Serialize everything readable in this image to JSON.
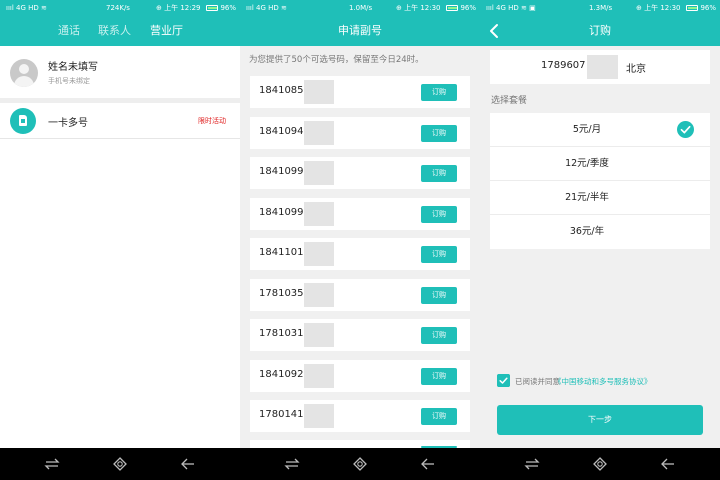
{
  "colors": {
    "accent": "#1fbfb8",
    "badge_red": "#e02020",
    "mask": "#e4e4e4"
  },
  "status_bars": [
    {
      "signal": "ıııl 4G HD ≋",
      "speed": "724K/s",
      "clock": "⊕ 上午 12:29",
      "battery_pct": "96%"
    },
    {
      "signal": "ıııl 4G HD ≋",
      "speed": "1.0M/s",
      "clock": "⊕ 上午 12:30",
      "battery_pct": "96%"
    },
    {
      "signal": "ıııl 4G HD ≋ ▣",
      "speed": "1.3M/s",
      "clock": "⊕ 上午 12:30",
      "battery_pct": "96%"
    }
  ],
  "screen1": {
    "tabs": [
      "通话",
      "联系人",
      "营业厅"
    ],
    "active_tab": "营业厅",
    "user_name": "姓名未填写",
    "user_sub": "手机号未绑定",
    "feature_label": "一卡多号",
    "feature_badge": "限时活动"
  },
  "screen2": {
    "title": "申请副号",
    "notice": "为您提供了50个可选号码，保留至今日24时。",
    "order_label": "订购",
    "numbers": [
      "1841085",
      "1841094",
      "1841099",
      "1841099",
      "1841101",
      "1781035",
      "1781031",
      "1841092",
      "1780141"
    ]
  },
  "screen3": {
    "title": "订购",
    "number": "1789607",
    "city": "北京",
    "section_label": "选择套餐",
    "plans": [
      "5元/月",
      "12元/季度",
      "21元/半年",
      "36元/年"
    ],
    "selected_plan": "5元/月",
    "agree_prefix": "已阅读并同意",
    "agree_link": "《中国移动和多号服务协议》",
    "next_label": "下一步"
  },
  "navbar": {
    "icons": [
      "recent-apps-icon",
      "home-icon",
      "back-icon"
    ]
  }
}
